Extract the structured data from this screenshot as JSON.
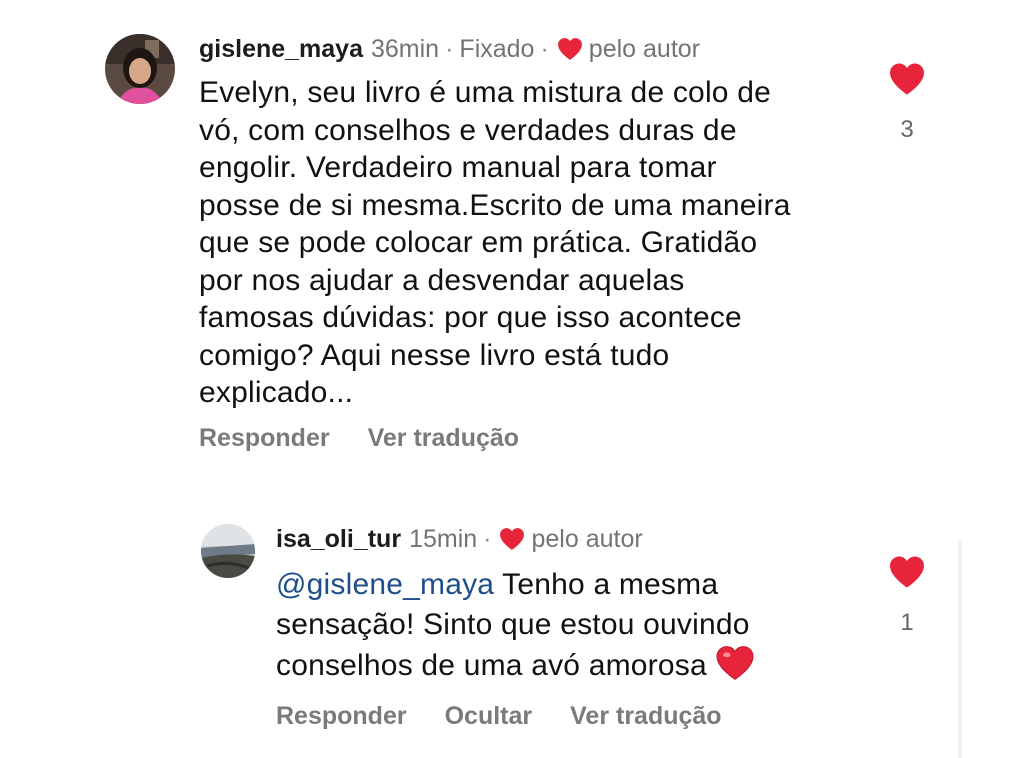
{
  "comments": [
    {
      "username": "gislene_maya",
      "time": "36min",
      "pinned": "Fixado",
      "separator": "·",
      "liked_by": "pelo autor",
      "body_lines": [
        "Evelyn, seu livro é uma mistura de colo de",
        "vó, com conselhos e verdades duras de",
        "engolir. Verdadeiro manual para tomar",
        "posse de si mesma.Escrito de uma maneira",
        "que se pode colocar em prática. Gratidão",
        "por nos ajudar a desvendar aquelas",
        "famosas dúvidas: por que isso acontece",
        "comigo? Aqui nesse livro está tudo",
        "explicado..."
      ],
      "actions": {
        "reply": "Responder",
        "translate": "Ver tradução"
      },
      "like_count": "3"
    },
    {
      "username": "isa_oli_tur",
      "time": "15min",
      "separator": "·",
      "liked_by": "pelo autor",
      "mention": "@gislene_maya",
      "body_line1_rest": " Tenho a mesma",
      "body_lines": [
        "sensação! Sinto que estou ouvindo",
        "conselhos de uma avó amorosa"
      ],
      "emoji": "heart-emoji",
      "actions": {
        "reply": "Responder",
        "hide": "Ocultar",
        "translate": "Ver tradução"
      },
      "like_count": "1"
    }
  ],
  "colors": {
    "heart": "#e8243b",
    "mention": "#1f4f8a",
    "muted": "#737373"
  }
}
